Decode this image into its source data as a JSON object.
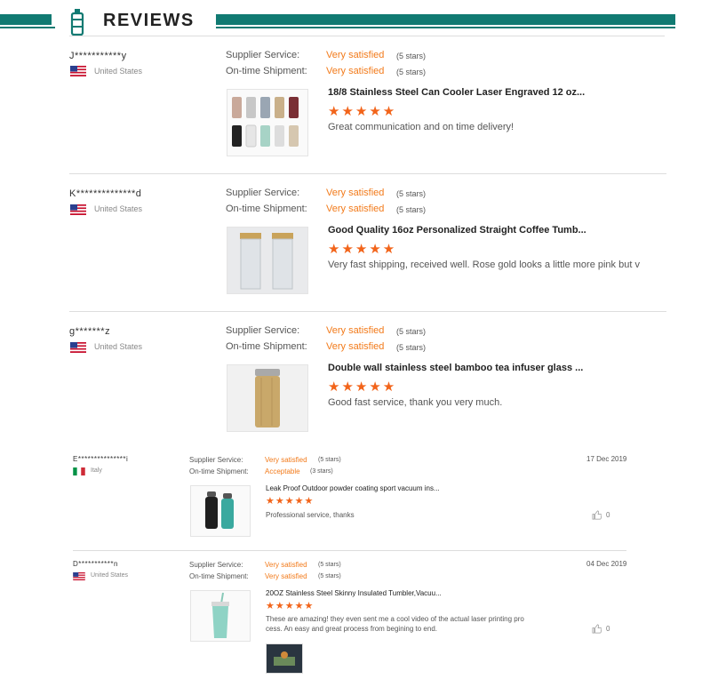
{
  "header": {
    "title": "REVIEWS",
    "accent": "#117a72"
  },
  "reviews": [
    {
      "name": "J***********y",
      "country": "United States",
      "supplier_label": "Supplier Service:",
      "supplier_value": "Very satisfied",
      "supplier_stars": "(5 stars)",
      "shipment_label": "On-time Shipment:",
      "shipment_value": "Very satisfied",
      "shipment_stars": "(5 stars)",
      "product": "18/8 Stainless Steel Can Cooler Laser Engraved 12 oz...",
      "rating": "★★★★★",
      "comment": "Great communication and on time delivery!"
    },
    {
      "name": "K**************d",
      "country": "United States",
      "supplier_label": "Supplier Service:",
      "supplier_value": "Very satisfied",
      "supplier_stars": "(5 stars)",
      "shipment_label": "On-time Shipment:",
      "shipment_value": "Very satisfied",
      "shipment_stars": "(5 stars)",
      "product": "Good Quality 16oz Personalized Straight Coffee Tumb...",
      "rating": "★★★★★",
      "comment": "Very fast shipping, received well. Rose gold looks a little more pink but v"
    },
    {
      "name": "g*******z",
      "country": "United States",
      "supplier_label": "Supplier Service:",
      "supplier_value": "Very satisfied",
      "supplier_stars": "(5 stars)",
      "shipment_label": "On-time Shipment:",
      "shipment_value": "Very satisfied",
      "shipment_stars": "(5 stars)",
      "product": "Double wall stainless steel bamboo tea infuser glass ...",
      "rating": "★★★★★",
      "comment": "Good fast service, thank you very much."
    },
    {
      "name": "E***************i",
      "country": "Italy",
      "date": "17 Dec 2019",
      "supplier_label": "Supplier Service:",
      "supplier_value": "Very satisfied",
      "supplier_stars": "(5 stars)",
      "shipment_label": "On-time Shipment:",
      "shipment_value": "Acceptable",
      "shipment_stars": "(3 stars)",
      "product": "Leak Proof Outdoor powder coating sport vacuum ins...",
      "rating": "★★★★★",
      "comment": "Professional service, thanks",
      "likes": "0"
    },
    {
      "name": "D***********n",
      "country": "United States",
      "date": "04 Dec 2019",
      "supplier_label": "Supplier Service:",
      "supplier_value": "Very satisfied",
      "supplier_stars": "(5 stars)",
      "shipment_label": "On-time Shipment:",
      "shipment_value": "Very satisfied",
      "shipment_stars": "(5 stars)",
      "product": "20OZ Stainless Steel Skinny Insulated Tumbler,Vacuu...",
      "rating": "★★★★★",
      "comment_line1": "These are amazing! they even sent me a cool video of the actual laser printing pro",
      "comment_line2": "cess. An easy and great process from begining to end.",
      "likes": "0"
    }
  ]
}
